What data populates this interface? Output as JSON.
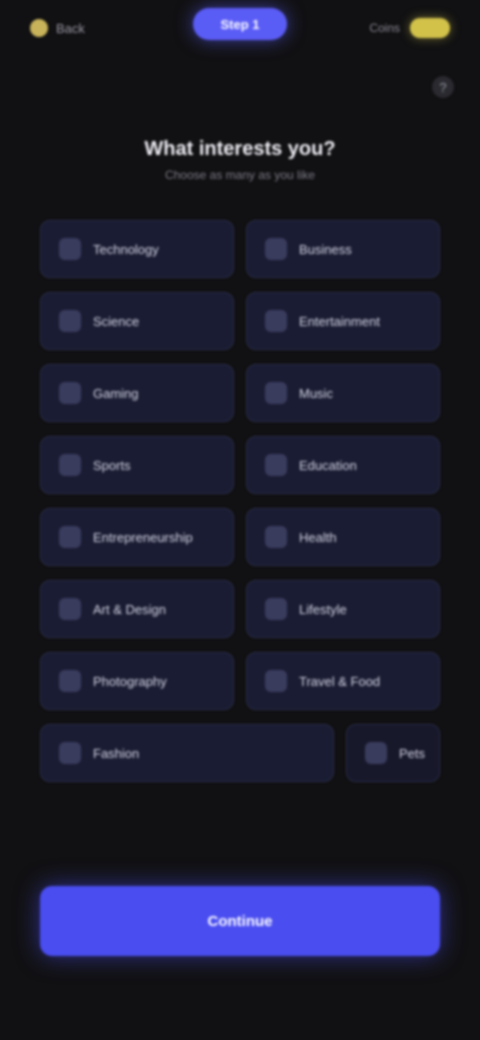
{
  "header": {
    "back_label": "Back",
    "center_pill": "Step 1",
    "right_label": "Coins"
  },
  "title": "What interests you?",
  "subtitle": "Choose as many as you like",
  "options": [
    [
      "Technology",
      "Business"
    ],
    [
      "Science",
      "Entertainment"
    ],
    [
      "Gaming",
      "Music"
    ],
    [
      "Sports",
      "Education"
    ],
    [
      "Entrepreneurship",
      "Health"
    ],
    [
      "Art & Design",
      "Lifestyle"
    ],
    [
      "Photography",
      "Travel & Food"
    ],
    [
      "Fashion",
      "Pets"
    ]
  ],
  "cta_label": "Continue"
}
